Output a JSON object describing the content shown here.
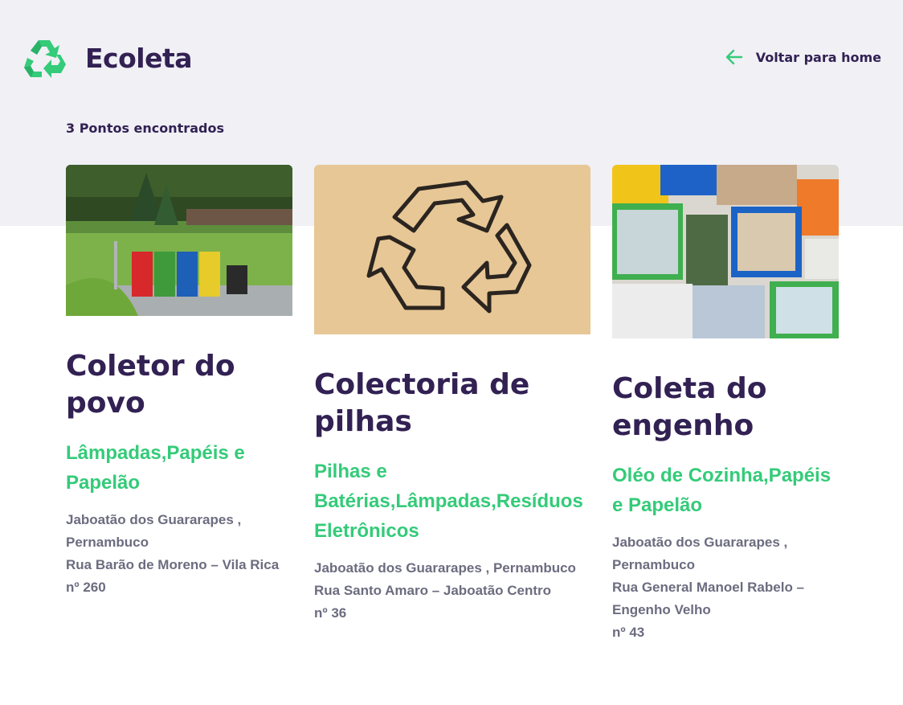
{
  "header": {
    "app_name": "Ecoleta",
    "logo_icon": "recycle-icon",
    "back_label": "Voltar para home",
    "back_icon": "arrow-left-icon"
  },
  "colors": {
    "primary": "#322153",
    "accent": "#34CB79",
    "background_band": "#F0F0F5",
    "text_muted": "#6C6C80"
  },
  "results": {
    "count_label": "3 Pontos encontrados"
  },
  "cards": [
    {
      "title": "Coletor do povo",
      "items": "Lâmpadas,Papéis e Papelão",
      "city_state": "Jaboatão dos Guararapes , Pernambuco",
      "street": "Rua Barão de Moreno – Vila Rica",
      "number": "nº 260"
    },
    {
      "title": "Colectoria de pilhas",
      "items": "Pilhas e Batérias,Lâmpadas,Resíduos Eletrônicos",
      "city_state": "Jaboatão dos Guararapes , Pernambuco",
      "street": "Rua Santo Amaro – Jaboatão Centro",
      "number": "nº 36"
    },
    {
      "title": "Coleta do engenho",
      "items": "Oléo de Cozinha,Papéis e Papelão",
      "city_state": "Jaboatão dos Guararapes , Pernambuco",
      "street": "Rua General Manoel Rabelo – Engenho Velho",
      "number": "nº 43"
    }
  ]
}
